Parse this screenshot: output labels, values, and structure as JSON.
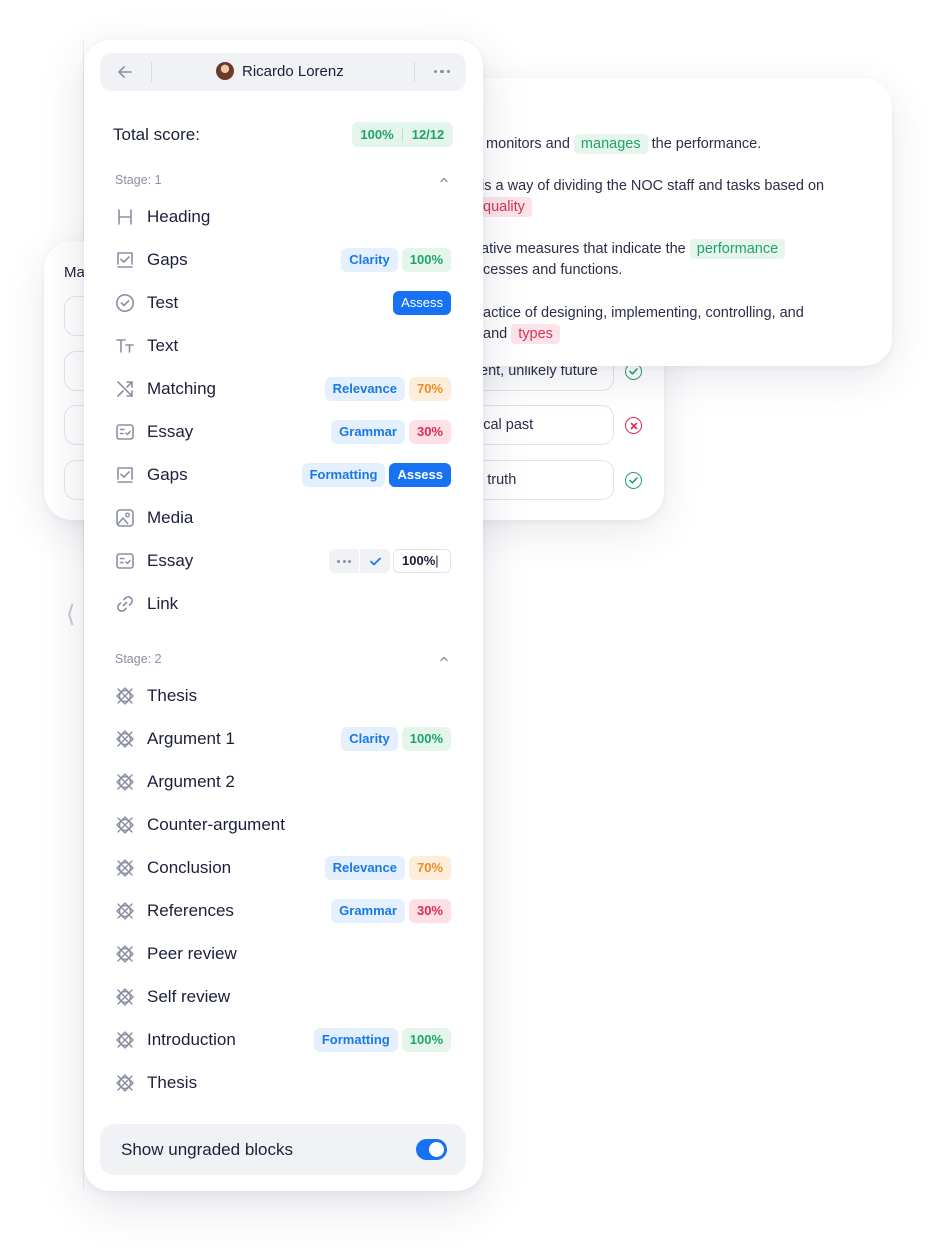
{
  "background_card": {
    "sentences": [
      {
        "pre": "t monitors and ",
        "highlight": "manages",
        "hl_type": "correct",
        "post": " the performance."
      },
      {
        "pre": "is a way of dividing the NOC staff and tasks based on",
        "highlight": "",
        "hl_type": "",
        "post": ""
      },
      {
        "pre": "",
        "highlight": "quality",
        "hl_type": "incorrect",
        "post": ""
      },
      {
        "pre": "ative measures that indicate the ",
        "highlight": "performance",
        "hl_type": "correct",
        "post": ""
      },
      {
        "pre": "cesses and functions.",
        "highlight": "",
        "hl_type": "",
        "post": ""
      },
      {
        "pre": "actice of designing, implementing, controlling, and",
        "highlight": "",
        "hl_type": "",
        "post": ""
      },
      {
        "pre": "and ",
        "highlight": "types",
        "hl_type": "incorrect",
        "post": ""
      }
    ]
  },
  "matching_card": {
    "title": "Ma",
    "answers": [
      {
        "text": "ent, unlikely future",
        "status": "correct"
      },
      {
        "text": "ical past",
        "status": "incorrect"
      },
      {
        "text": "l truth",
        "status": "correct"
      }
    ]
  },
  "panel": {
    "user_name": "Ricardo Lorenz",
    "total_label": "Total score:",
    "total_percent": "100%",
    "total_count": "12/12",
    "stages": [
      {
        "label": "Stage: 1",
        "blocks": [
          {
            "label": "Heading",
            "icon": "heading-icon"
          },
          {
            "label": "Gaps",
            "icon": "gaps-icon",
            "tag": "Clarity",
            "score": "100%",
            "score_type": "green"
          },
          {
            "label": "Test",
            "icon": "test-check-icon",
            "button": "Assess"
          },
          {
            "label": "Text",
            "icon": "text-icon"
          },
          {
            "label": "Matching",
            "icon": "matching-shuffle-icon",
            "tag": "Relevance",
            "score": "70%",
            "score_type": "orange"
          },
          {
            "label": "Essay",
            "icon": "essay-icon",
            "tag": "Grammar",
            "score": "30%",
            "score_type": "red"
          },
          {
            "label": "Gaps",
            "icon": "gaps-icon",
            "tag": "Formatting",
            "button": "Assess"
          },
          {
            "label": "Media",
            "icon": "media-icon"
          },
          {
            "label": "Essay",
            "icon": "essay-icon",
            "edit_value": "100%"
          },
          {
            "label": "Link",
            "icon": "link-icon"
          }
        ]
      },
      {
        "label": "Stage: 2",
        "blocks": [
          {
            "label": "Thesis",
            "icon": "ungraded-block-icon"
          },
          {
            "label": "Argument 1",
            "icon": "ungraded-block-icon",
            "tag": "Clarity",
            "score": "100%",
            "score_type": "green"
          },
          {
            "label": "Argument 2",
            "icon": "ungraded-block-icon"
          },
          {
            "label": "Counter-argument",
            "icon": "ungraded-block-icon"
          },
          {
            "label": "Conclusion",
            "icon": "ungraded-block-icon",
            "tag": "Relevance",
            "score": "70%",
            "score_type": "orange"
          },
          {
            "label": "References",
            "icon": "ungraded-block-icon",
            "tag": "Grammar",
            "score": "30%",
            "score_type": "red"
          },
          {
            "label": "Peer review",
            "icon": "ungraded-block-icon"
          },
          {
            "label": "Self review",
            "icon": "ungraded-block-icon"
          },
          {
            "label": "Introduction",
            "icon": "ungraded-block-icon",
            "tag": "Formatting",
            "score": "100%",
            "score_type": "green"
          },
          {
            "label": "Thesis",
            "icon": "ungraded-block-icon"
          }
        ]
      }
    ],
    "show_ungraded_label": "Show ungraded blocks",
    "show_ungraded_on": true
  },
  "colors": {
    "accent": "#1672f3",
    "correct": "#1fa36b",
    "incorrect": "#dc2e52",
    "warning": "#f08a24"
  }
}
